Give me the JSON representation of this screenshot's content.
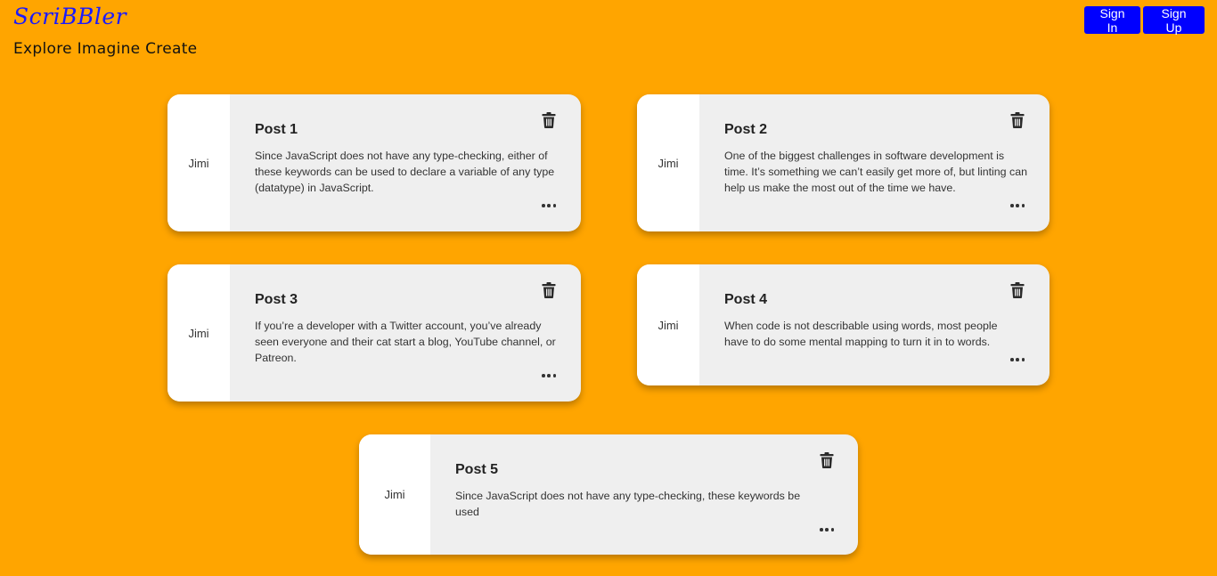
{
  "brand": {
    "logo_text": "ScriBBler",
    "tagline": "Explore Imagine Create"
  },
  "auth": {
    "sign_in": "Sign In",
    "sign_up": "Sign Up"
  },
  "colors": {
    "background": "#FFA500",
    "button": "#0000FF",
    "card": "#EFEFEF",
    "author_panel": "#FFFFFF"
  },
  "icons": [
    "trash-icon",
    "more-options-icon"
  ],
  "posts": [
    {
      "author": "Jimi",
      "title": "Post 1",
      "body": "Since JavaScript does not have any type-checking, either of these keywords can be used to declare a variable of any type (datatype) in JavaScript."
    },
    {
      "author": "Jimi",
      "title": "Post 2",
      "body": "One of the biggest challenges in software development is time. It’s something we can’t easily get more of, but linting can help us make the most out of the time we have."
    },
    {
      "author": "Jimi",
      "title": "Post 3",
      "body": "If you’re a developer with a Twitter account, you’ve already seen everyone and their cat start a blog, YouTube channel, or Patreon."
    },
    {
      "author": "Jimi",
      "title": "Post 4",
      "body": "When code is not describable using words, most people have to do some mental mapping to turn it in to words."
    },
    {
      "author": "Jimi",
      "title": "Post 5",
      "body": "Since JavaScript does not have any type-checking, these keywords be used"
    }
  ]
}
